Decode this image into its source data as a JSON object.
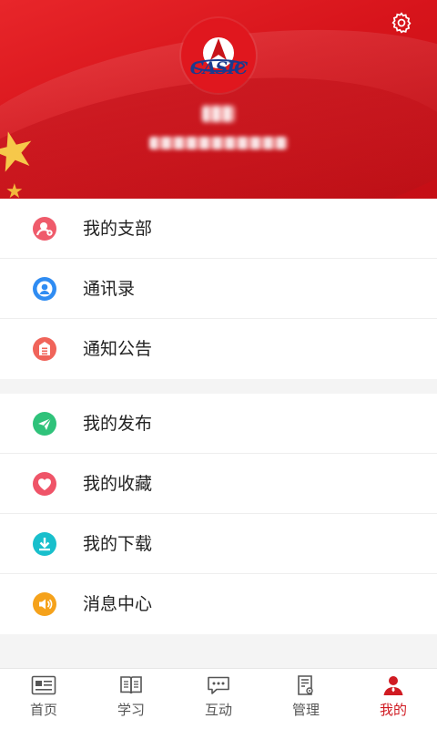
{
  "header": {
    "logo_text": "CASIC",
    "settings_icon": "gear-icon",
    "user_name_blurred": true,
    "user_org_blurred": true,
    "bg_color": "#d7141b"
  },
  "menu_group_1": [
    {
      "label": "我的支部",
      "icon": "branch-icon",
      "color": "#ef5b6b"
    },
    {
      "label": "通讯录",
      "icon": "contacts-icon",
      "color": "#2f8cf2"
    },
    {
      "label": "通知公告",
      "icon": "notice-icon",
      "color": "#f0645a"
    }
  ],
  "menu_group_2": [
    {
      "label": "我的发布",
      "icon": "send-icon",
      "color": "#2fc27a"
    },
    {
      "label": "我的收藏",
      "icon": "heart-icon",
      "color": "#ef5468"
    },
    {
      "label": "我的下载",
      "icon": "download-icon",
      "color": "#19bfcc"
    },
    {
      "label": "消息中心",
      "icon": "speaker-icon",
      "color": "#f5a21b"
    }
  ],
  "tabbar": {
    "tabs": [
      {
        "label": "首页",
        "icon": "home-card-icon"
      },
      {
        "label": "学习",
        "icon": "book-icon"
      },
      {
        "label": "互动",
        "icon": "chat-icon"
      },
      {
        "label": "管理",
        "icon": "manage-doc-icon"
      },
      {
        "label": "我的",
        "icon": "profile-icon",
        "active": true
      }
    ],
    "active_color": "#d01b22"
  }
}
